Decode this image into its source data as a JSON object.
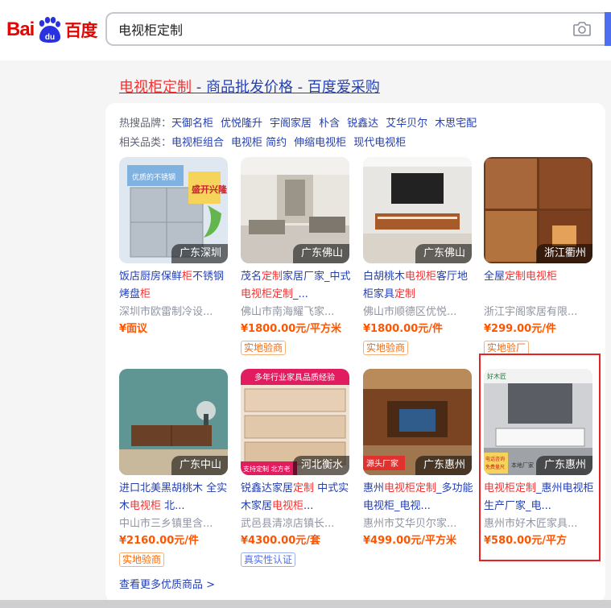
{
  "search": {
    "query": "电视柜定制"
  },
  "result": {
    "title_highlight": "电视柜定制",
    "title_rest": " - 商品批发价格 - 百度爱采购",
    "hot_brands_label": "热搜品牌：",
    "hot_brands": [
      "天御名柜",
      "优悦隆升",
      "宇阁家居",
      "朴含",
      "锐鑫达",
      "艾华贝尔",
      "木思宅配"
    ],
    "related_label": "相关品类：",
    "related": [
      "电视柜组合",
      "电视柜 简约",
      "伸缩电视柜",
      "现代电视柜"
    ],
    "more_link": "查看更多优质商品 >"
  },
  "products": [
    {
      "location": "广东深圳",
      "title_parts": [
        [
          "饭店厨房保鲜",
          false
        ],
        [
          "柜",
          true
        ],
        [
          "不锈钢烤盘",
          false
        ],
        [
          "柜",
          true
        ]
      ],
      "seller": "深圳市欧雷制冷设...",
      "price": "¥面议",
      "tag": "",
      "thumb_text": [
        "优质的不锈钢",
        "盛开兴隆"
      ]
    },
    {
      "location": "广东佛山",
      "title_parts": [
        [
          "茂名",
          false
        ],
        [
          "定制",
          true
        ],
        [
          "家居厂家_中式",
          false
        ],
        [
          "电视柜定制",
          true
        ],
        [
          "_...",
          false
        ]
      ],
      "seller": "佛山市南海耀飞家...",
      "price": "¥1800.00元/平方米",
      "tag": "实地验商",
      "thumb_text": []
    },
    {
      "location": "广东佛山",
      "title_parts": [
        [
          "白胡桃木",
          false
        ],
        [
          "电视柜",
          true
        ],
        [
          "客厅地柜家具",
          false
        ],
        [
          "定制",
          true
        ]
      ],
      "seller": "佛山市顺德区优悦...",
      "price": "¥1800.00元/件",
      "tag": "实地验商",
      "thumb_text": []
    },
    {
      "location": "浙江衢州",
      "title_parts": [
        [
          "全屋",
          false
        ],
        [
          "定制电视柜",
          true
        ]
      ],
      "seller": "浙江宇阁家居有限...",
      "price": "¥299.00元/件",
      "tag": "实地验厂",
      "thumb_text": []
    },
    {
      "location": "广东中山",
      "title_parts": [
        [
          "进口北美黑胡桃木 全实木",
          false
        ],
        [
          "电视柜",
          true
        ],
        [
          " 北...",
          false
        ]
      ],
      "seller": "中山市三乡镇里含...",
      "price": "¥2160.00元/件",
      "tag": "实地验商",
      "thumb_text": []
    },
    {
      "location": "河北衡水",
      "title_parts": [
        [
          "锐鑫达家居",
          false
        ],
        [
          "定制",
          true
        ],
        [
          " 中式实木家居",
          false
        ],
        [
          "电视柜",
          true
        ],
        [
          "...",
          false
        ]
      ],
      "seller": "武邑县清凉店镇长...",
      "price": "¥4300.00元/套",
      "tag": "真实性认证",
      "thumb_text": [
        "多年行业家具品质经验",
        "支持定制 北方老"
      ]
    },
    {
      "location": "广东惠州",
      "title_parts": [
        [
          "惠州",
          false
        ],
        [
          "电视柜定制",
          true
        ],
        [
          "_多功能电视柜_电视...",
          false
        ]
      ],
      "seller": "惠州市艾华贝尔家...",
      "price": "¥499.00元/平方米",
      "tag": "",
      "thumb_text": [
        "源头厂家"
      ]
    },
    {
      "location": "广东惠州",
      "title_parts": [
        [
          "电视柜定制",
          true
        ],
        [
          "_惠州电视柜生产厂家_电...",
          false
        ]
      ],
      "seller": "惠州市好木匠家具...",
      "price": "¥580.00元/平方",
      "tag": "",
      "thumb_text": [
        "好木匠",
        "电话咨询 免费量尺",
        "本地厂家"
      ]
    }
  ],
  "colors": {
    "brand_red": "#e10601",
    "link_blue": "#2440b3",
    "price_orange": "#ff5500",
    "highlight_red": "#f73131",
    "search_blue": "#4e6ef2"
  },
  "icons": {
    "camera": "camera-icon",
    "logo": "baidu-paw-logo"
  }
}
